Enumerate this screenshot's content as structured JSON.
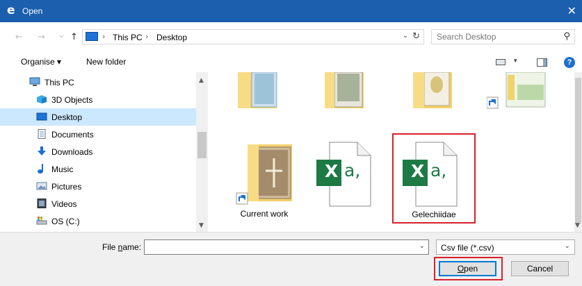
{
  "window": {
    "title": "Open",
    "app_icon": "ie-logo-icon",
    "close_glyph": "✕"
  },
  "nav": {
    "back_glyph": "←",
    "forward_glyph": "→",
    "recent_glyph": "⌄",
    "up_glyph": "↑"
  },
  "address": {
    "separator": "›",
    "crumbs": [
      "This PC",
      "Desktop"
    ],
    "dropdown_glyph": "⌄",
    "refresh_glyph": "↻"
  },
  "search": {
    "placeholder": "Search Desktop",
    "icon": "search-icon"
  },
  "toolbar": {
    "organise_label": "Organise",
    "organise_caret": "▾",
    "new_folder_label": "New folder",
    "view_caret": "▾",
    "help_label": "?"
  },
  "sidebar": {
    "items": [
      {
        "label": "This PC",
        "icon": "computer-icon"
      },
      {
        "label": "3D Objects",
        "icon": "cube-icon"
      },
      {
        "label": "Desktop",
        "icon": "desktop-icon",
        "selected": true
      },
      {
        "label": "Documents",
        "icon": "document-icon"
      },
      {
        "label": "Downloads",
        "icon": "download-icon"
      },
      {
        "label": "Music",
        "icon": "music-icon"
      },
      {
        "label": "Pictures",
        "icon": "pictures-icon"
      },
      {
        "label": "Videos",
        "icon": "video-icon"
      },
      {
        "label": "OS (C:)",
        "icon": "drive-icon"
      }
    ],
    "scroll_up_glyph": "▲",
    "scroll_down_glyph": "▼"
  },
  "content": {
    "files": [
      {
        "name": "",
        "icon": "folder-icon"
      },
      {
        "name": "",
        "icon": "folder-icon"
      },
      {
        "name": "",
        "icon": "folder-icon"
      },
      {
        "name": "",
        "icon": "shortcut-icon"
      },
      {
        "name": "Current work",
        "icon": "folder-shortcut-icon"
      },
      {
        "name": "",
        "icon": "excel-csv-icon",
        "tag_x": "X",
        "tag_suffix": "a,"
      },
      {
        "name": "Gelechiidae",
        "icon": "excel-csv-icon",
        "tag_x": "X",
        "tag_suffix": "a,",
        "highlighted": true
      }
    ]
  },
  "footer": {
    "file_name_label_pre": "File ",
    "file_name_label_underlined": "n",
    "file_name_label_post": "ame:",
    "file_name_value": "",
    "file_name_dropdown_glyph": "⌄",
    "file_type_value": "Csv file (*.csv)",
    "file_type_dropdown_glyph": "⌄",
    "open_label_underlined": "O",
    "open_label_rest": "pen",
    "cancel_label": "Cancel"
  },
  "colors": {
    "title_bar": "#1b5fae",
    "selection": "#cce8ff",
    "highlight": "#d8202a",
    "excel_green": "#1d7a45",
    "folder_yellow": "#f4cf6a"
  }
}
